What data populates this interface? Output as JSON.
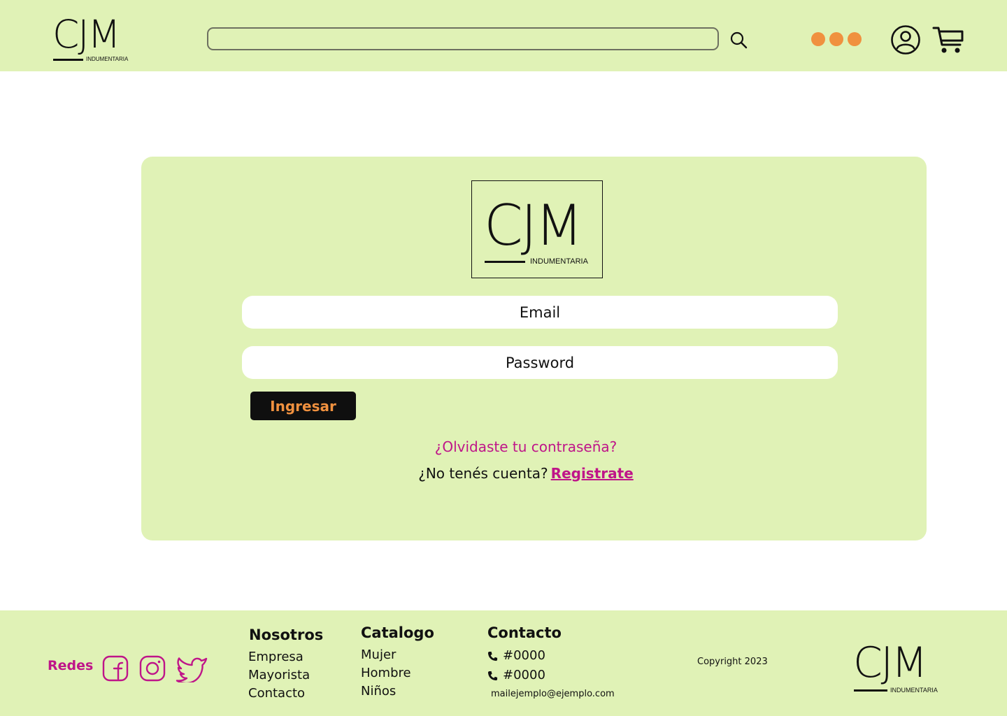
{
  "brand": {
    "name": "CJM",
    "tagline": "INDUMENTARIA"
  },
  "header": {
    "search": {
      "placeholder": "",
      "value": ""
    },
    "icons": {
      "search": "search-icon",
      "menu": "more-dots-icon",
      "account": "user-circle-icon",
      "cart": "shopping-cart-icon"
    }
  },
  "login": {
    "email_placeholder": "Email",
    "password_placeholder": "Password",
    "submit_label": "Ingresar",
    "forgot_label": "¿Olvidaste tu contraseña?",
    "no_account_text": "¿No tenés cuenta?",
    "register_label": "Registrate"
  },
  "footer": {
    "social_label": "Redes",
    "social_icons": [
      "facebook-icon",
      "instagram-icon",
      "twitter-icon"
    ],
    "columns": {
      "nosotros": {
        "title": "Nosotros",
        "links": [
          "Empresa",
          "Mayorista",
          "Contacto"
        ]
      },
      "catalogo": {
        "title": "Catalogo",
        "links": [
          "Mujer",
          "Hombre",
          "Niños"
        ]
      },
      "contacto": {
        "title": "Contacto",
        "phones": [
          "#0000",
          "#0000"
        ],
        "email": "mailejemplo@ejemplo.com"
      }
    },
    "copyright": "Copyright 2023"
  },
  "colors": {
    "background_green": "#e0f2b6",
    "accent_orange": "#f0913f",
    "accent_magenta": "#bf1589",
    "dark": "#111111"
  }
}
